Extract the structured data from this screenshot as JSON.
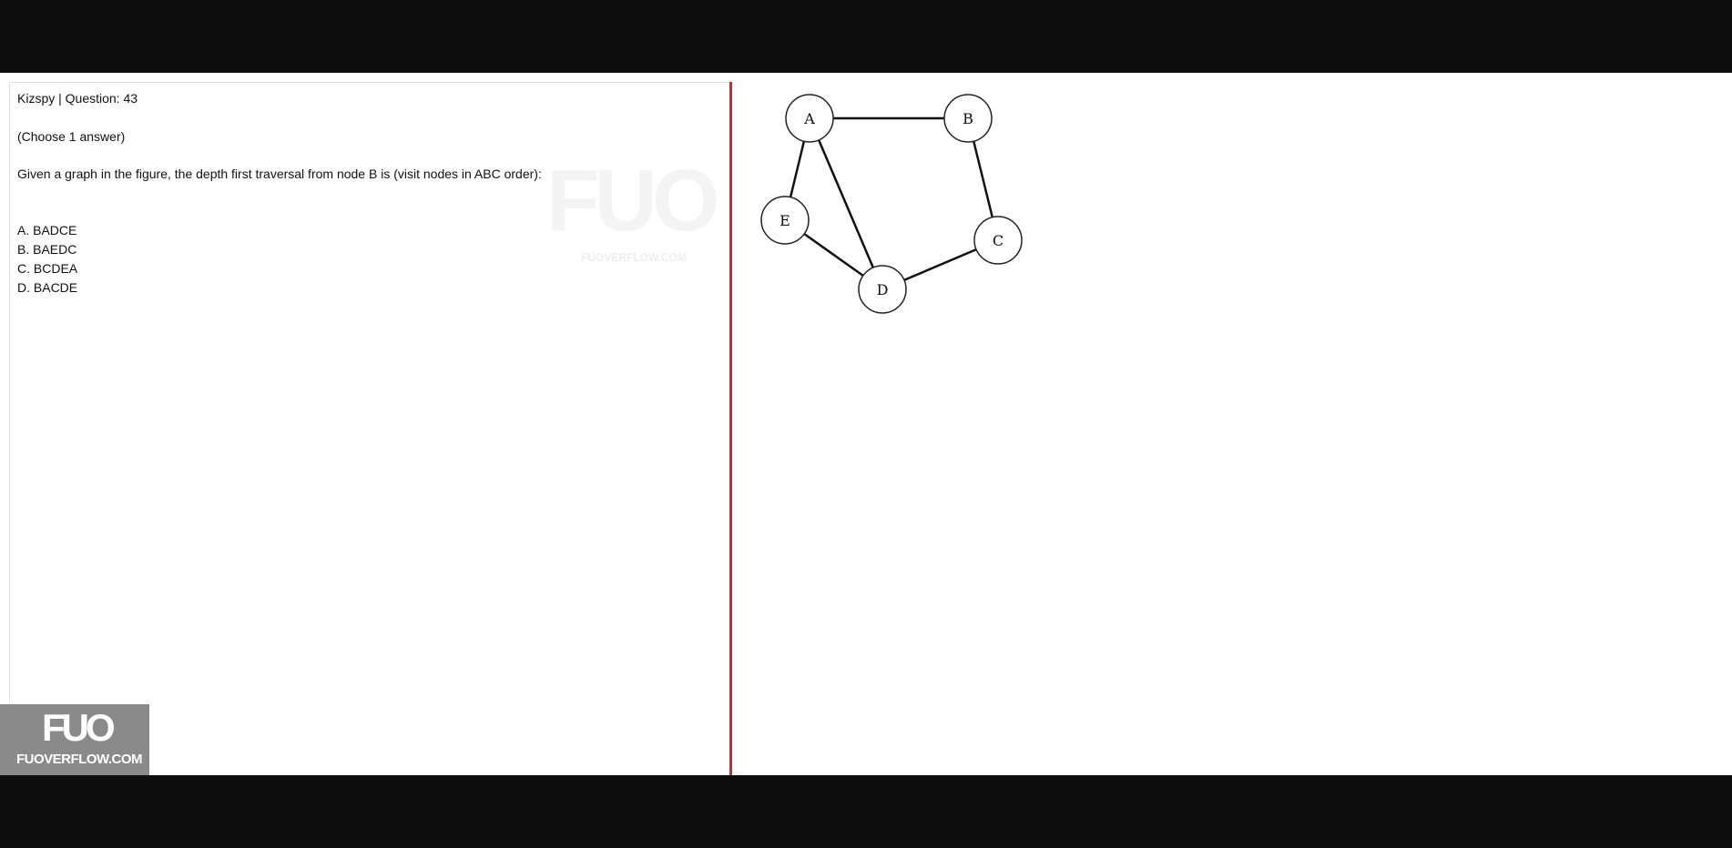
{
  "question": {
    "header": "Kizspy | Question: 43",
    "hint": "(Choose 1 answer)",
    "text": "Given a graph in the figure, the depth first traversal from node B is (visit nodes in ABC order):",
    "options": [
      {
        "label": "A. BADCE"
      },
      {
        "label": "B. BAEDC"
      },
      {
        "label": "C. BCDEA"
      },
      {
        "label": "D. BACDE"
      }
    ]
  },
  "graph": {
    "nodes": [
      "A",
      "B",
      "C",
      "D",
      "E"
    ],
    "edges": [
      [
        "A",
        "B"
      ],
      [
        "A",
        "E"
      ],
      [
        "A",
        "D"
      ],
      [
        "B",
        "C"
      ],
      [
        "C",
        "D"
      ],
      [
        "D",
        "E"
      ]
    ]
  },
  "watermark": {
    "logo": "FUO",
    "site": "FUOVERFLOW.COM"
  },
  "brand": {
    "logo": "FUO",
    "site": "FUOVERFLOW.COM"
  },
  "colors": {
    "divider": "#d9242b",
    "brand_badge": "#8a8a8a",
    "frame": "#0d0d0d"
  }
}
